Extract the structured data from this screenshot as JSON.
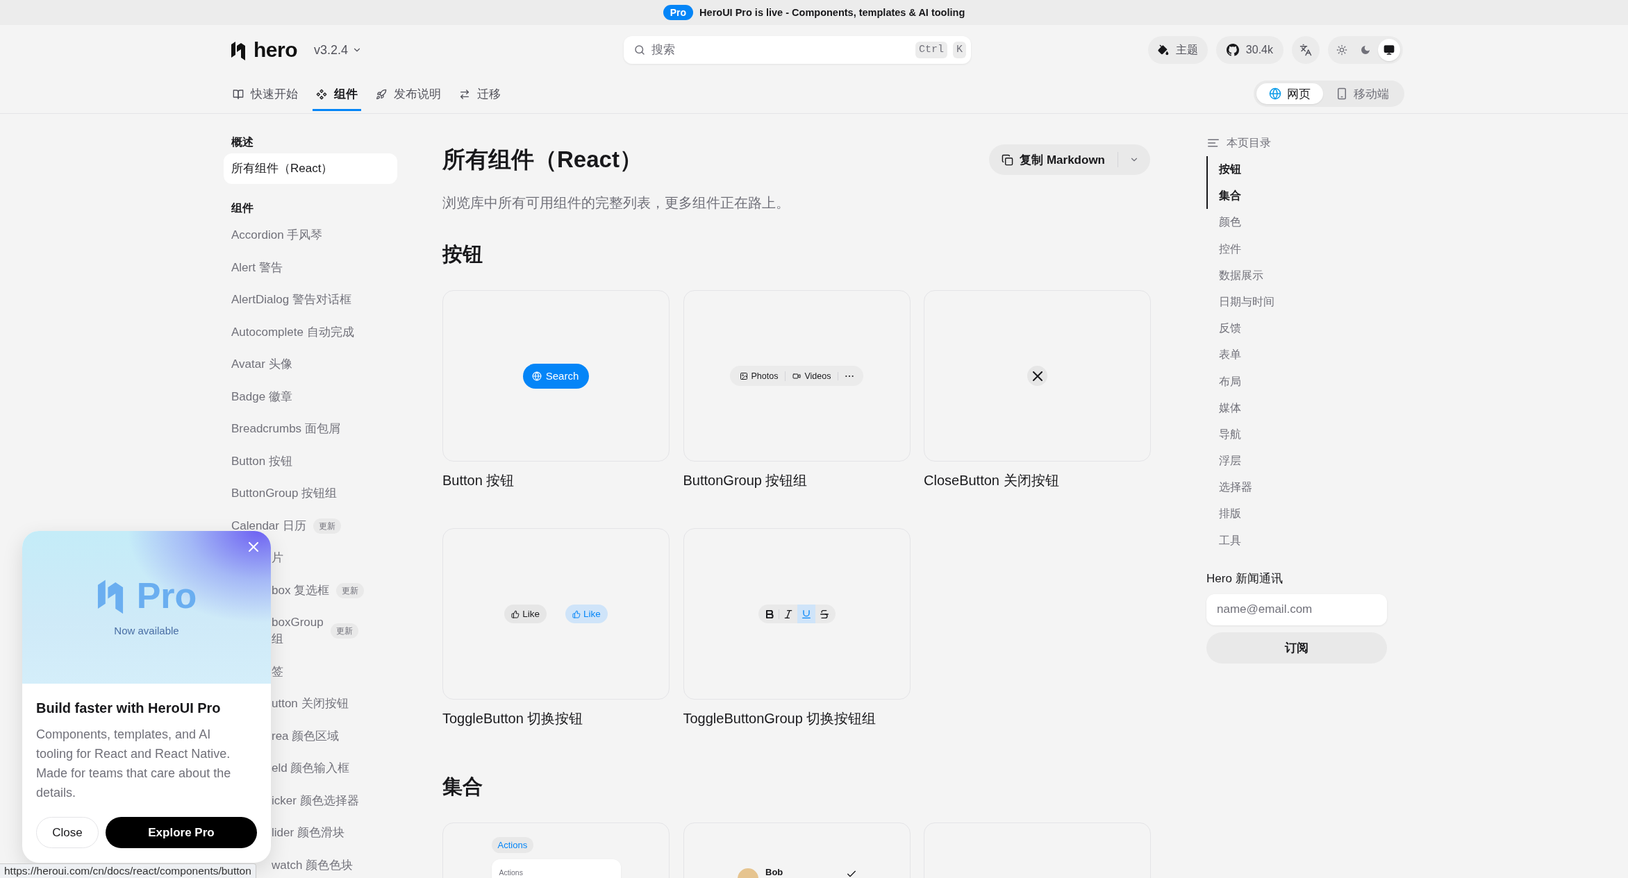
{
  "banner": {
    "badge": "Pro",
    "text": "HeroUI Pro is live - Components, templates & AI tooling"
  },
  "header": {
    "logo": "hero",
    "version": "v3.2.4",
    "search": {
      "placeholder": "搜索",
      "shortcut": [
        "Ctrl",
        "K"
      ]
    },
    "theme_button": "主题",
    "github_stars": "30.4k",
    "color_modes": [
      {
        "kind": "light",
        "selected": false
      },
      {
        "kind": "dark",
        "selected": false
      },
      {
        "kind": "system",
        "selected": true
      }
    ]
  },
  "nav_tabs": [
    {
      "kind": "book",
      "label": "快速开始",
      "selected": false
    },
    {
      "kind": "components",
      "label": "组件",
      "selected": true
    },
    {
      "kind": "rocket",
      "label": "发布说明",
      "selected": false
    },
    {
      "kind": "migrate",
      "label": "迁移",
      "selected": false
    }
  ],
  "platforms": [
    {
      "kind": "web",
      "label": "网页",
      "selected": true
    },
    {
      "kind": "mobile",
      "label": "移动端",
      "selected": false
    }
  ],
  "sidebar": [
    {
      "title": "概述",
      "items": [
        {
          "label": "所有组件（React）",
          "selected": true,
          "covered": false
        }
      ]
    },
    {
      "title": "组件",
      "items": [
        {
          "label": "Accordion 手风琴",
          "selected": false,
          "covered": false
        },
        {
          "label": "Alert 警告",
          "selected": false,
          "covered": false
        },
        {
          "label": "AlertDialog 警告对话框",
          "selected": false,
          "covered": false
        },
        {
          "label": "Autocomplete 自动完成",
          "selected": false,
          "covered": false
        },
        {
          "label": "Avatar 头像",
          "selected": false,
          "covered": false
        },
        {
          "label": "Badge 徽章",
          "selected": false,
          "covered": false
        },
        {
          "label": "Breadcrumbs 面包屑",
          "selected": false,
          "covered": false
        },
        {
          "label": "Button 按钮",
          "selected": false,
          "covered": false
        },
        {
          "label": "ButtonGroup 按钮组",
          "selected": false,
          "covered": false
        },
        {
          "label": "Calendar 日历",
          "badge": "更新",
          "selected": false,
          "covered": false
        },
        {
          "label": "片",
          "selected": false,
          "covered": true
        },
        {
          "label": "box 复选框",
          "badge": "更新",
          "selected": false,
          "covered": true
        },
        {
          "label": "boxGroup\n组",
          "badge": "更新",
          "selected": false,
          "covered": true
        },
        {
          "label": "签",
          "selected": false,
          "covered": true
        },
        {
          "label": "utton 关闭按钮",
          "selected": false,
          "covered": true
        },
        {
          "label": "rea 颜色区域",
          "selected": false,
          "covered": true
        },
        {
          "label": "eld 颜色输入框",
          "selected": false,
          "covered": true
        },
        {
          "label": "icker 颜色选择器",
          "selected": false,
          "covered": true
        },
        {
          "label": "lider 颜色滑块",
          "selected": false,
          "covered": true
        },
        {
          "label": "watch 颜色色块",
          "selected": false,
          "covered": true
        }
      ]
    }
  ],
  "page": {
    "title": "所有组件（React）",
    "copy_button": "复制 Markdown",
    "subtitle": "浏览库中所有可用组件的完整列表，更多组件正在路上。",
    "sections": [
      {
        "title": "按钮",
        "cards": [
          {
            "label": "Button 按钮",
            "preview": {
              "kind": "button",
              "label": "Search"
            }
          },
          {
            "label": "ButtonGroup 按钮组",
            "preview": {
              "kind": "button_group",
              "items": [
                {
                  "kind": "photos",
                  "label": "Photos"
                },
                {
                  "kind": "videos",
                  "label": "Videos"
                },
                {
                  "kind": "more"
                }
              ]
            }
          },
          {
            "label": "CloseButton 关闭按钮",
            "preview": {
              "kind": "close_button"
            }
          },
          {
            "label": "ToggleButton 切换按钮",
            "preview": {
              "kind": "toggle_buttons",
              "items": [
                {
                  "label": "Like",
                  "selected": false
                },
                {
                  "label": "Like",
                  "selected": true
                }
              ]
            }
          },
          {
            "label": "ToggleButtonGroup 切换按钮组",
            "preview": {
              "kind": "toggle_group",
              "items": [
                {
                  "kind": "bold",
                  "selected": false
                },
                {
                  "kind": "italic",
                  "selected": false
                },
                {
                  "kind": "underline",
                  "selected": true
                },
                {
                  "kind": "strikethrough",
                  "selected": false
                }
              ]
            }
          }
        ]
      },
      {
        "title": "集合",
        "cards": [
          {
            "preview": {
              "kind": "dropdown",
              "trigger": "Actions",
              "menu_title": "Actions"
            }
          },
          {
            "preview": {
              "kind": "user_list",
              "items": [
                {
                  "name": "Bob",
                  "selected": true
                }
              ]
            }
          },
          {
            "preview": {
              "kind": "blank"
            }
          }
        ]
      }
    ]
  },
  "toc": {
    "title": "本页目录",
    "items": [
      {
        "label": "按钮",
        "selected": true
      },
      {
        "label": "集合",
        "selected": true
      },
      {
        "label": "颜色",
        "selected": false
      },
      {
        "label": "控件",
        "selected": false
      },
      {
        "label": "数据展示",
        "selected": false
      },
      {
        "label": "日期与时间",
        "selected": false
      },
      {
        "label": "反馈",
        "selected": false
      },
      {
        "label": "表单",
        "selected": false
      },
      {
        "label": "布局",
        "selected": false
      },
      {
        "label": "媒体",
        "selected": false
      },
      {
        "label": "导航",
        "selected": false
      },
      {
        "label": "浮层",
        "selected": false
      },
      {
        "label": "选择器",
        "selected": false
      },
      {
        "label": "排版",
        "selected": false
      },
      {
        "label": "工具",
        "selected": false
      }
    ],
    "newsletter": {
      "title": "Hero 新闻通讯",
      "placeholder": "name@email.com",
      "button": "订阅"
    }
  },
  "popup": {
    "logo": "Pro",
    "tagline": "Now available",
    "title": "Build faster with HeroUI Pro",
    "body": "Components, templates, and AI tooling for React and React Native. Made for teams that care about the details.",
    "buttons": [
      {
        "kind": "secondary",
        "label": "Close"
      },
      {
        "kind": "primary",
        "label": "Explore Pro"
      }
    ]
  },
  "status_url": "https://heroui.com/cn/docs/react/components/button"
}
